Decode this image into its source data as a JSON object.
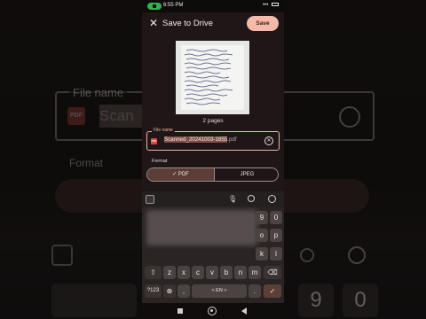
{
  "status_bar": {
    "time": "6:55 PM",
    "right_text": "•••"
  },
  "app_bar": {
    "close_glyph": "✕",
    "title": "Save to Drive",
    "save_label": "Save"
  },
  "preview": {
    "pages_label": "2 pages"
  },
  "file_name": {
    "label": "File name",
    "pdf_badge": "PDF",
    "value_selected": "Scanned_20241003-1855",
    "value_extension": ".pdf",
    "clear_glyph": "✕"
  },
  "format": {
    "label": "Format",
    "options": [
      {
        "label": "PDF",
        "selected": true
      },
      {
        "label": "JPEG",
        "selected": false
      }
    ],
    "check_glyph": "✓"
  },
  "keyboard": {
    "row_numbers": [
      "9",
      "0"
    ],
    "row_letters_end": [
      "o",
      "p"
    ],
    "row_k_l": [
      "k",
      "l"
    ],
    "row_shift": [
      "z",
      "x",
      "c",
      "v",
      "b",
      "n",
      "m"
    ],
    "bottom": {
      "mode": "?123",
      "comma": ",",
      "space": "< EN >",
      "period": "."
    },
    "icons": [
      "grid-icon",
      "mic-icon",
      "search-icon",
      "emoji-icon",
      "shift-icon",
      "backspace-icon",
      "globe-icon",
      "enter-icon"
    ],
    "shift_glyph": "⇧",
    "backspace_glyph": "⌫",
    "globe_glyph": "⊕",
    "enter_glyph": "✓"
  },
  "background": {
    "file_label": "File name",
    "scan_text": "Scan",
    "format_label": "Format",
    "keys": [
      "9",
      "0"
    ]
  },
  "accent_colors": {
    "primary": "#f5b9a9",
    "outline": "#f0b3a4",
    "pdf": "#d24c3e"
  }
}
